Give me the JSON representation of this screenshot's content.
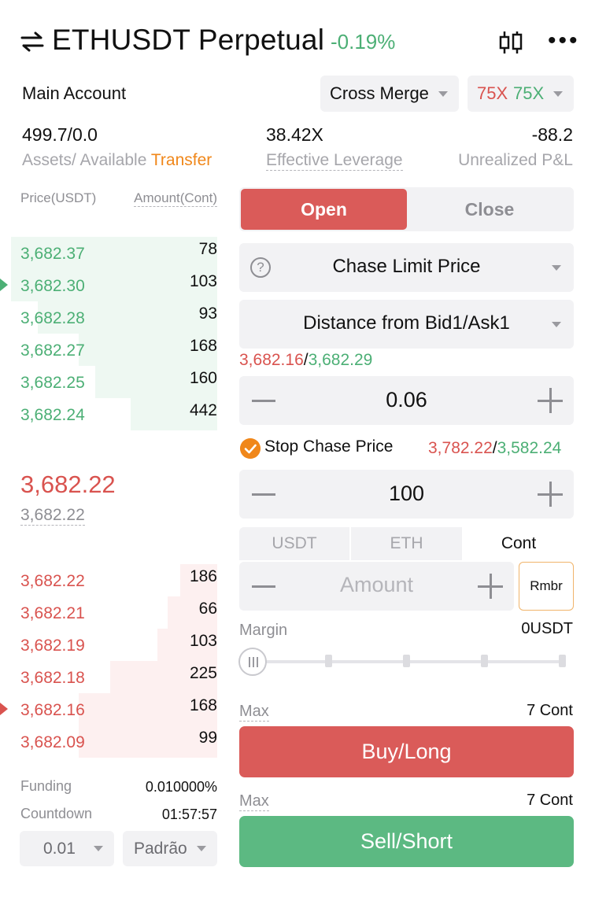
{
  "header": {
    "pair": "ETHUSDT Perpetual",
    "change": "-0.19%"
  },
  "account": {
    "label": "Main Account",
    "margin_mode": "Cross Merge",
    "leverage_long": "75X",
    "leverage_short": "75X"
  },
  "stats": {
    "assets_value": "499.7/0.0",
    "assets_label": "Assets/ Available",
    "transfer_label": "Transfer",
    "effective_leverage_value": "38.42X",
    "effective_leverage_label": "Effective Leverage",
    "unrealized_pnl_value": "-88.2",
    "unrealized_pnl_label": "Unrealized P&L"
  },
  "orderbook": {
    "price_header": "Price(USDT)",
    "amount_header": "Amount(Cont)",
    "asks": [
      {
        "price": "3,682.37",
        "amount": "78",
        "depth": 1.0
      },
      {
        "price": "3,682.30",
        "amount": "103",
        "depth": 1.0
      },
      {
        "price": "3,682.28",
        "amount": "93",
        "depth": 0.87
      },
      {
        "price": "3,682.27",
        "amount": "168",
        "depth": 0.67
      },
      {
        "price": "3,682.25",
        "amount": "160",
        "depth": 0.59
      },
      {
        "price": "3,682.24",
        "amount": "442",
        "depth": 0.42
      }
    ],
    "last_price": "3,682.22",
    "mark_price": "3,682.22",
    "bids": [
      {
        "price": "3,682.22",
        "amount": "186",
        "depth": 0.18
      },
      {
        "price": "3,682.21",
        "amount": "66",
        "depth": 0.24
      },
      {
        "price": "3,682.19",
        "amount": "103",
        "depth": 0.29
      },
      {
        "price": "3,682.18",
        "amount": "225",
        "depth": 0.52
      },
      {
        "price": "3,682.16",
        "amount": "168",
        "depth": 0.67
      },
      {
        "price": "3,682.09",
        "amount": "99",
        "depth": 0.67
      }
    ],
    "funding_label": "Funding",
    "funding_value": "0.010000%",
    "countdown_label": "Countdown",
    "countdown_value": "01:57:57",
    "precision": "0.01",
    "style": "Padrão"
  },
  "order_form": {
    "tab_open": "Open",
    "tab_close": "Close",
    "order_type": "Chase Limit Price",
    "chase_mode": "Distance from Bid1/Ask1",
    "bid1": "3,682.16",
    "ask1": "3,682.29",
    "distance": "0.06",
    "stop_chase_label": "Stop Chase Price",
    "stop_chase_high": "3,782.22",
    "stop_chase_low": "3,582.24",
    "stop_distance": "100",
    "unit_tabs": [
      "USDT",
      "ETH",
      "Cont"
    ],
    "amount_placeholder": "Amount",
    "rmbr_label": "Rmbr",
    "margin_label": "Margin",
    "margin_value": "0USDT",
    "slider_percent": 0,
    "max_label": "Max",
    "buy_max": "7 Cont",
    "buy_label": "Buy/Long",
    "sell_max": "7 Cont",
    "sell_label": "Sell/Short"
  },
  "colors": {
    "red": "#da5b59",
    "green": "#5cb982",
    "orange": "#f0871a"
  }
}
